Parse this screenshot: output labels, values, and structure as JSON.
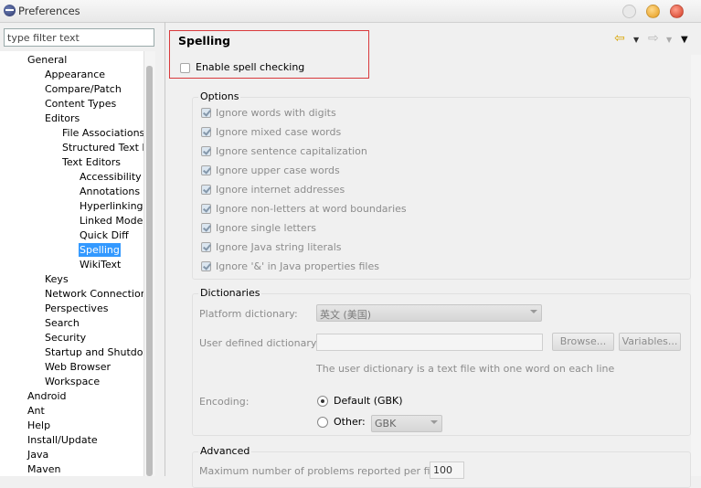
{
  "window": {
    "title": "Preferences"
  },
  "filter": {
    "placeholder": "type filter text"
  },
  "tree": [
    {
      "label": "General",
      "depth": 1
    },
    {
      "label": "Appearance",
      "depth": 2
    },
    {
      "label": "Compare/Patch",
      "depth": 2
    },
    {
      "label": "Content Types",
      "depth": 2
    },
    {
      "label": "Editors",
      "depth": 2
    },
    {
      "label": "File Associations",
      "depth": 3
    },
    {
      "label": "Structured Text Ed",
      "depth": 3
    },
    {
      "label": "Text Editors",
      "depth": 3
    },
    {
      "label": "Accessibility",
      "depth": 4
    },
    {
      "label": "Annotations",
      "depth": 4
    },
    {
      "label": "Hyperlinking",
      "depth": 4
    },
    {
      "label": "Linked Mode",
      "depth": 4
    },
    {
      "label": "Quick Diff",
      "depth": 4
    },
    {
      "label": "Spelling",
      "depth": 4,
      "selected": true
    },
    {
      "label": "WikiText",
      "depth": 4
    },
    {
      "label": "Keys",
      "depth": 2
    },
    {
      "label": "Network Connection",
      "depth": 2
    },
    {
      "label": "Perspectives",
      "depth": 2
    },
    {
      "label": "Search",
      "depth": 2
    },
    {
      "label": "Security",
      "depth": 2
    },
    {
      "label": "Startup and Shutdow",
      "depth": 2
    },
    {
      "label": "Web Browser",
      "depth": 2
    },
    {
      "label": "Workspace",
      "depth": 2
    },
    {
      "label": "Android",
      "depth": 1
    },
    {
      "label": "Ant",
      "depth": 1
    },
    {
      "label": "Help",
      "depth": 1
    },
    {
      "label": "Install/Update",
      "depth": 1
    },
    {
      "label": "Java",
      "depth": 1
    },
    {
      "label": "Maven",
      "depth": 1
    }
  ],
  "page": {
    "title": "Spelling",
    "enable_label": "Enable spell checking",
    "enable_checked": false
  },
  "options": {
    "title": "Options",
    "items": [
      {
        "label": "Ignore words with digits",
        "checked": true
      },
      {
        "label": "Ignore mixed case words",
        "checked": true
      },
      {
        "label": "Ignore sentence capitalization",
        "checked": true
      },
      {
        "label": "Ignore upper case words",
        "checked": true
      },
      {
        "label": "Ignore internet addresses",
        "checked": true
      },
      {
        "label": "Ignore non-letters at word boundaries",
        "checked": true
      },
      {
        "label": "Ignore single letters",
        "checked": true
      },
      {
        "label": "Ignore Java string literals",
        "checked": true
      },
      {
        "label": "Ignore '&' in Java properties files",
        "checked": true
      }
    ]
  },
  "dictionaries": {
    "title": "Dictionaries",
    "platform_label": "Platform dictionary:",
    "platform_value": "英文 (美国)",
    "user_label": "User defined dictionary:",
    "user_value": "",
    "browse_label": "Browse...",
    "variables_label": "Variables...",
    "hint": "The user dictionary is a text file with one word on each line",
    "encoding_label": "Encoding:",
    "default_label": "Default (GBK)",
    "other_label": "Other:",
    "other_value": "GBK",
    "selected_encoding": "default"
  },
  "advanced": {
    "title": "Advanced",
    "max_problems_label": "Maximum number of problems reported per file:",
    "max_problems_value": "100"
  },
  "colors": {
    "selection": "#3399ff",
    "highlight_border": "#d9393c"
  }
}
